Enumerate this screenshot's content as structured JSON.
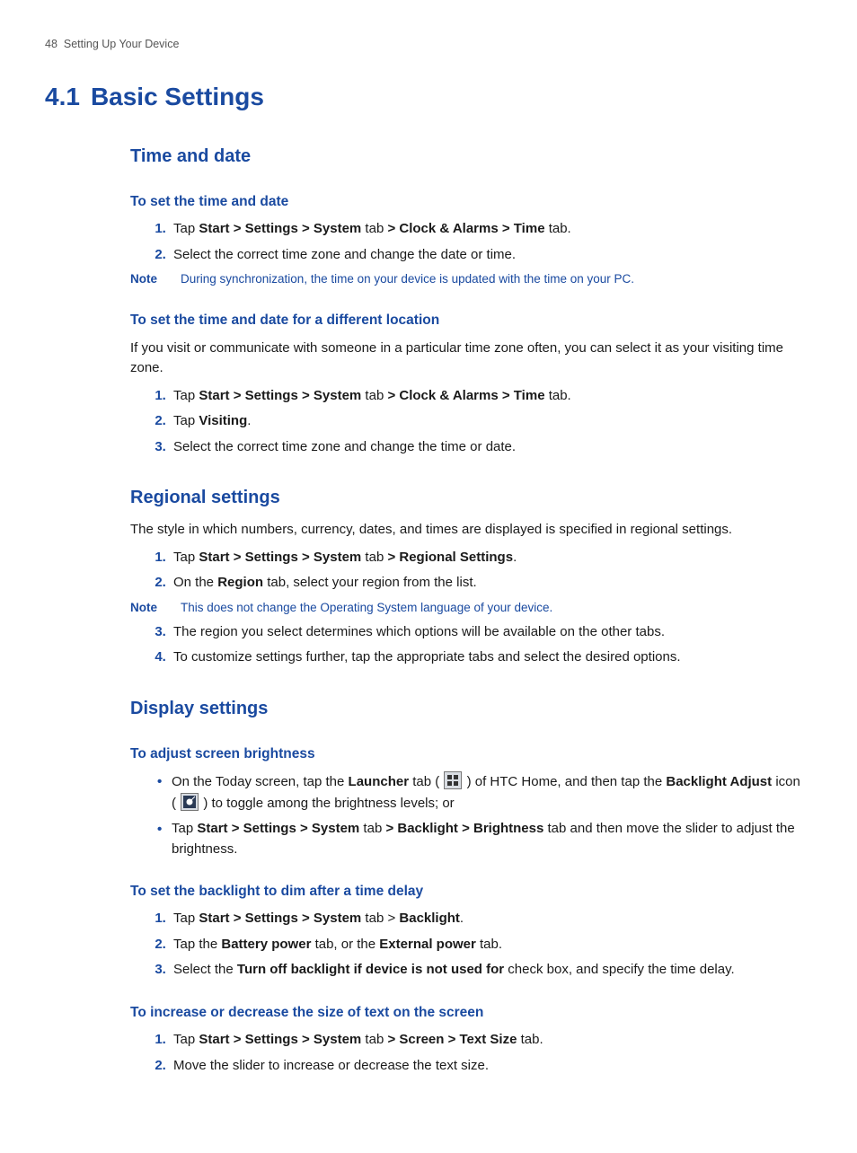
{
  "header": {
    "pageNumber": "48",
    "sectionName": "Setting Up Your Device"
  },
  "chapter": {
    "number": "4.1",
    "title": "Basic Settings"
  },
  "time_date": {
    "title": "Time and date",
    "set_time": {
      "heading": "To set the time and date",
      "s1a": "Tap ",
      "s1b": "Start > Settings > System",
      "s1c": " tab ",
      "s1d": "> Clock & Alarms > Time",
      "s1e": " tab.",
      "s2": "Select the correct time zone and change the date or time.",
      "noteLabel": "Note",
      "note": "During synchronization, the time on your device is updated with the time on your PC."
    },
    "diff_loc": {
      "heading": "To set the time and date for a different location",
      "intro": "If you visit or communicate with someone in a particular time zone often, you can select it as your visiting time zone.",
      "s1a": "Tap ",
      "s1b": "Start > Settings > System",
      "s1c": " tab ",
      "s1d": "> Clock & Alarms > Time",
      "s1e": " tab.",
      "s2a": "Tap ",
      "s2b": "Visiting",
      "s2c": ".",
      "s3": "Select the correct time zone and change the time or date."
    }
  },
  "regional": {
    "title": "Regional settings",
    "intro": "The style in which numbers, currency, dates, and times are displayed is specified in regional settings.",
    "s1a": "Tap ",
    "s1b": "Start > Settings > System",
    "s1c": " tab ",
    "s1d": "> Regional Settings",
    "s1e": ".",
    "s2a": "On the ",
    "s2b": "Region",
    "s2c": " tab, select your region from the list.",
    "noteLabel": "Note",
    "note": "This does not change the Operating System language of your device.",
    "s3": "The region you select determines which options will be available on the other tabs.",
    "s4": "To customize settings further, tap the appropriate tabs and select the desired options."
  },
  "display": {
    "title": "Display settings",
    "brightness": {
      "heading": "To adjust screen brightness",
      "b1a": "On the Today screen, tap the ",
      "b1b": "Launcher",
      "b1c": " tab ( ",
      "b1d": " ) of HTC Home, and then tap the ",
      "b1e": "Backlight Adjust",
      "b1f": " icon",
      "b1g": "( ",
      "b1h": " ) to toggle among the brightness levels; or",
      "b2a": "Tap ",
      "b2b": "Start > Settings > System",
      "b2c": " tab ",
      "b2d": "> Backlight > Brightness",
      "b2e": " tab and then move the slider to adjust the brightness."
    },
    "dim": {
      "heading": "To set the backlight to dim after a time delay",
      "s1a": "Tap ",
      "s1b": "Start > Settings > System",
      "s1c": " tab > ",
      "s1d": "Backlight",
      "s1e": ".",
      "s2a": "Tap the ",
      "s2b": "Battery power",
      "s2c": " tab, or the ",
      "s2d": "External power",
      "s2e": " tab.",
      "s3a": "Select the ",
      "s3b": "Turn off backlight if device is not used for",
      "s3c": " check box, and specify the time delay."
    },
    "textsize": {
      "heading": "To increase or decrease the size of text on the screen",
      "s1a": "Tap ",
      "s1b": "Start > Settings > System",
      "s1c": " tab ",
      "s1d": "> Screen > Text Size",
      "s1e": " tab.",
      "s2": "Move the slider to increase or decrease the text size."
    }
  }
}
